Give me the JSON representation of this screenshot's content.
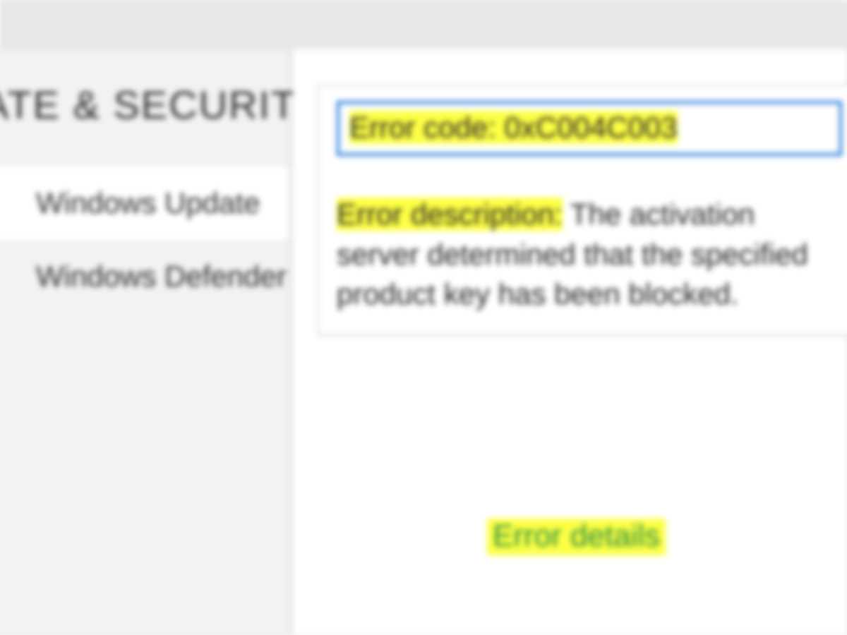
{
  "colors": {
    "highlight": "#fdff44",
    "link_green": "#228b3c",
    "focus_border": "#1e74d8",
    "bg_sidebar": "#f2f2f2",
    "bg_selected": "#ffffff"
  },
  "sidebar": {
    "section_title": "UPDATE & SECURITY",
    "items": [
      {
        "label": "Windows Update",
        "visible_fragment": "date",
        "selected": true
      },
      {
        "label": "Windows Defender",
        "visible_fragment": "ender",
        "selected": false
      }
    ]
  },
  "error": {
    "code_line": "Error code: 0xC004C003",
    "description_label": "Error description:",
    "description_rest": " The activation server determined that the specified product key has been blocked.",
    "description_visible_fragment_1": " The activati",
    "description_visible_fragment_2": "determined that the specifiec",
    "description_visible_fragment_3": "key has been blocked."
  },
  "links": {
    "error_details": "Error details"
  }
}
